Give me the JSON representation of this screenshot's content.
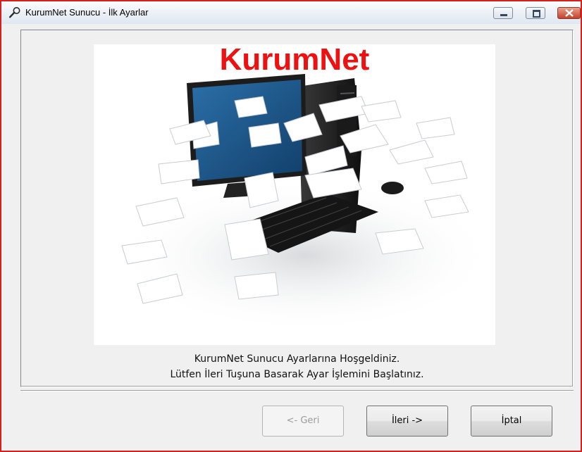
{
  "window": {
    "title": "KurumNet Sunucu - İlk Ayarlar"
  },
  "hero": {
    "brand": "KurumNet"
  },
  "message": {
    "line1": "KurumNet Sunucu Ayarlarına Hoşgeldiniz.",
    "line2": "Lütfen İleri Tuşuna Basarak Ayar İşlemini Başlatınız."
  },
  "buttons": {
    "back": "<- Geri",
    "next": "İleri ->",
    "cancel": "İptal"
  },
  "colors": {
    "frame": "#d61f1f",
    "brand": "#ee1111",
    "monitor_screen": "#1f5f95"
  },
  "icons": {
    "title": "wrench-icon",
    "minimize": "minimize-icon",
    "maximize": "maximize-icon",
    "close": "close-icon"
  }
}
